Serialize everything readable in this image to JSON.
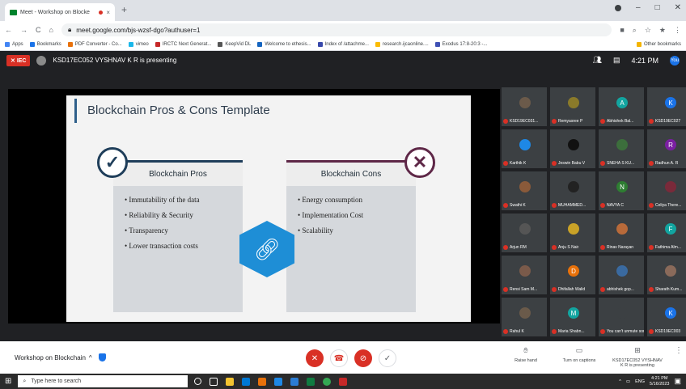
{
  "browser": {
    "tab_title": "Meet - Workshop on Blocke",
    "url": "meet.google.com/bjs-wzsf-dgo?authuser=1",
    "bookmarks": [
      "Apps",
      "Bookmarks",
      "PDF Converter - Co...",
      "vimeo",
      "IRCTC Next Generat...",
      "KeepVid DL",
      "Welcome to ethesis...",
      "Index of /attachme...",
      "research.ijcaonline....",
      "Exodus 17:8-20:3 -...",
      "Other bookmarks"
    ]
  },
  "meet": {
    "stop_label": "IEC",
    "presenter_text": "KSD17EC052 VYSHNAV K R is presenting",
    "time": "4:21 PM",
    "you_label": "You",
    "meeting_name": "Workshop on Blockchain",
    "controls": {
      "raise_hand": "Raise hand",
      "captions": "Turn on captions",
      "presenting": "KSD17EC052 VYSHNAV K R is presenting"
    }
  },
  "slide": {
    "title": "Blockchain Pros & Cons Template",
    "pros_title": "Blockchain Pros",
    "cons_title": "Blockchain Cons",
    "pros": [
      "Immutability of the data",
      "Reliability & Security",
      "Transparency",
      "Lower transaction costs"
    ],
    "cons": [
      "Energy consumption",
      "Implementation  Cost",
      "Scalability"
    ]
  },
  "participants": [
    {
      "name": "KSD19EC031...",
      "letter": "",
      "color": "#6b5a4a"
    },
    {
      "name": "Remyasree P",
      "letter": "",
      "color": "#8a7a2a"
    },
    {
      "name": "Abhishek Bal...",
      "letter": "A",
      "color": "#12a5a0"
    },
    {
      "name": "KSD19EC027",
      "letter": "K",
      "color": "#1a73e8"
    },
    {
      "name": "Karthik K",
      "letter": "",
      "color": "#1e88e5"
    },
    {
      "name": "Jeswin Babu V",
      "letter": "",
      "color": "#111111"
    },
    {
      "name": "SNEHA S KU...",
      "letter": "",
      "color": "#3c6e3c"
    },
    {
      "name": "Radhun A. R",
      "letter": "R",
      "color": "#7b1fa2"
    },
    {
      "name": "Swathi K",
      "letter": "",
      "color": "#8a5a3a"
    },
    {
      "name": "MUHAMMED...",
      "letter": "",
      "color": "#222222"
    },
    {
      "name": "NAVYA C",
      "letter": "N",
      "color": "#2e7d32"
    },
    {
      "name": "Celiya There...",
      "letter": "",
      "color": "#7a2a3a"
    },
    {
      "name": "Arjun RM",
      "letter": "",
      "color": "#555555"
    },
    {
      "name": "Anju S Nair",
      "letter": "",
      "color": "#c9a227"
    },
    {
      "name": "Rinav Narayan",
      "letter": "",
      "color": "#b86a3a"
    },
    {
      "name": "Fathima Alm...",
      "letter": "F",
      "color": "#12a5a0"
    },
    {
      "name": "Rensi Sam M...",
      "letter": "",
      "color": "#7a5a4a"
    },
    {
      "name": "Dhifallah Walid",
      "letter": "D",
      "color": "#e8710a"
    },
    {
      "name": "abhishek gop...",
      "letter": "",
      "color": "#3a6aa0"
    },
    {
      "name": "Sharath Kum...",
      "letter": "",
      "color": "#8a6a5a"
    },
    {
      "name": "Rahul K",
      "letter": "",
      "color": "#6a5a4a"
    },
    {
      "name": "Maria Shabn...",
      "letter": "M",
      "color": "#12a5a0"
    },
    {
      "name": "You can't unmute someone else",
      "letter": "",
      "color": "#3c4043"
    },
    {
      "name": "KSD19EC003",
      "letter": "K",
      "color": "#1a73e8"
    }
  ],
  "taskbar": {
    "search_placeholder": "Type here to search",
    "lang": "ENG",
    "clock": "4:21 PM",
    "date": "5/16/2023"
  }
}
